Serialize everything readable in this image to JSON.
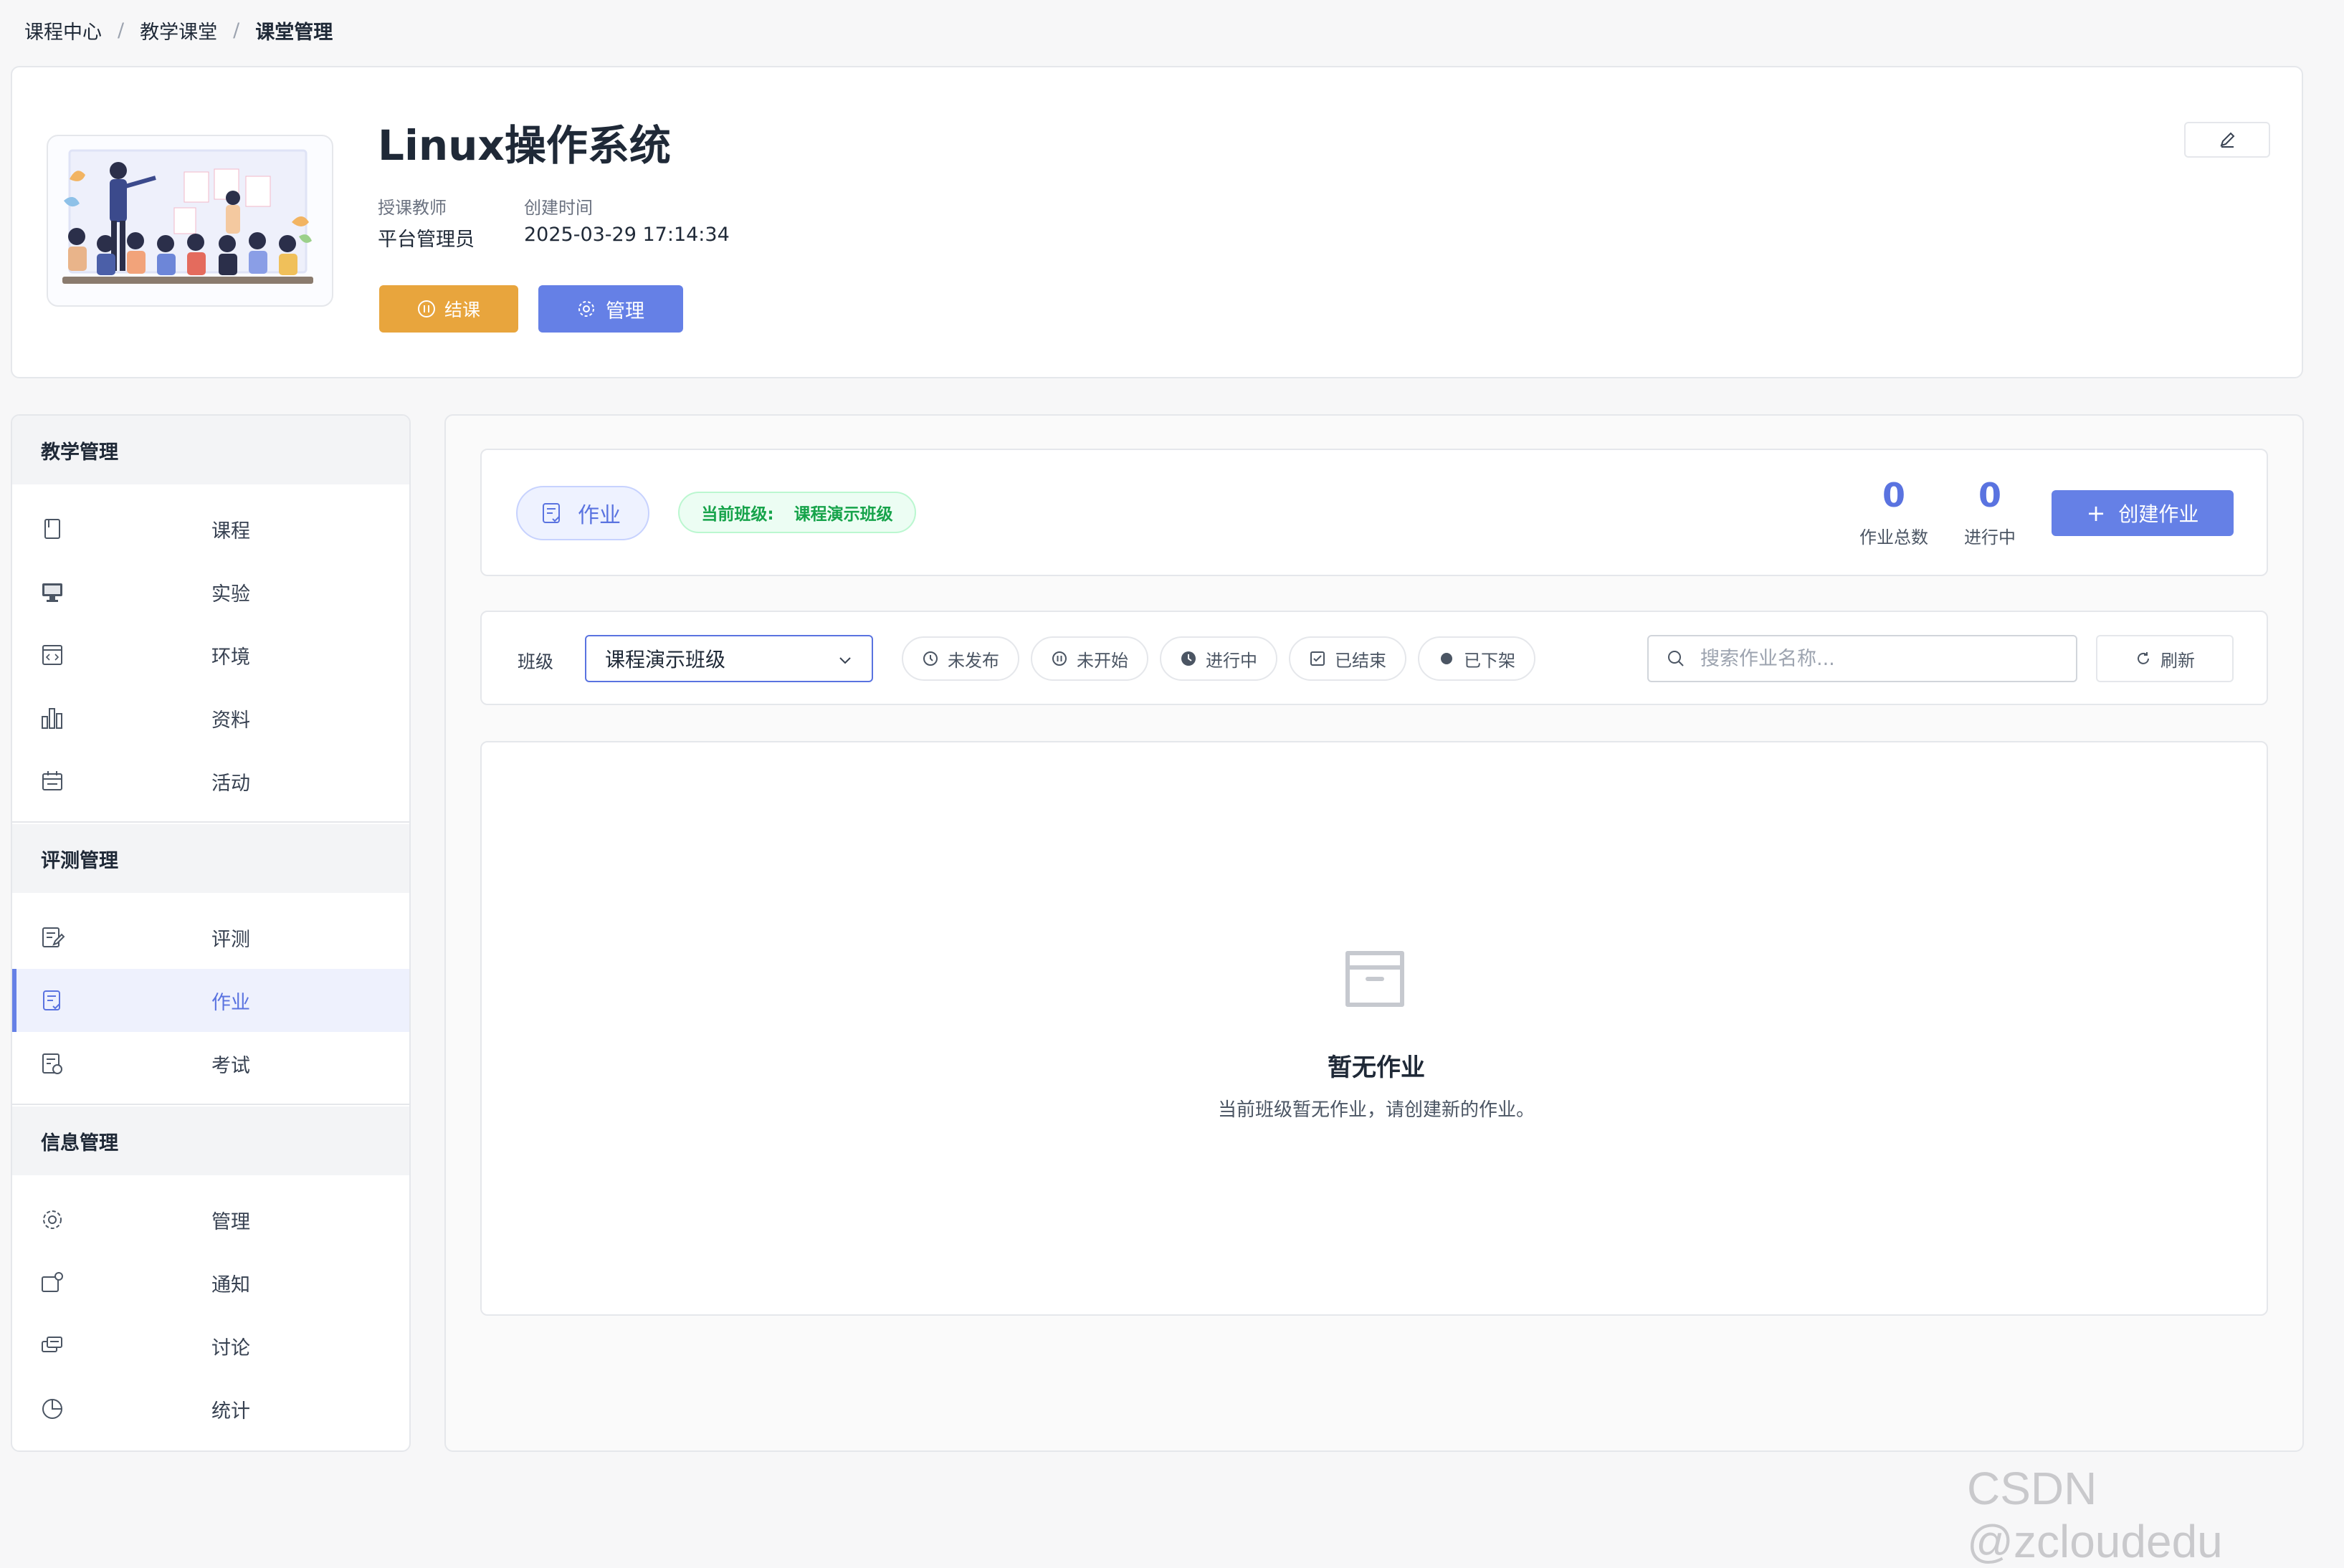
{
  "breadcrumb": {
    "items": [
      "课程中心",
      "教学课堂",
      "课堂管理"
    ]
  },
  "course": {
    "title": "Linux操作系统",
    "teacher_label": "授课教师",
    "teacher": "平台管理员",
    "created_label": "创建时间",
    "created": "2025-03-29 17:14:34",
    "end_button": "结课",
    "manage_button": "管理"
  },
  "sidebar": {
    "groups": [
      {
        "title": "教学管理",
        "items": [
          {
            "label": "课程",
            "icon": "book-icon"
          },
          {
            "label": "实验",
            "icon": "monitor-icon"
          },
          {
            "label": "环境",
            "icon": "code-window-icon"
          },
          {
            "label": "资料",
            "icon": "bar-chart-icon"
          },
          {
            "label": "活动",
            "icon": "calendar-icon"
          }
        ]
      },
      {
        "title": "评测管理",
        "items": [
          {
            "label": "评测",
            "icon": "edit-document-icon"
          },
          {
            "label": "作业",
            "icon": "assignment-icon",
            "active": true
          },
          {
            "label": "考试",
            "icon": "exam-icon"
          }
        ]
      },
      {
        "title": "信息管理",
        "items": [
          {
            "label": "管理",
            "icon": "gear-icon"
          },
          {
            "label": "通知",
            "icon": "notification-icon"
          },
          {
            "label": "讨论",
            "icon": "chat-icon"
          },
          {
            "label": "统计",
            "icon": "pie-chart-icon"
          }
        ]
      }
    ]
  },
  "homework": {
    "tab_label": "作业",
    "class_prefix": "当前班级:",
    "class_name": "课程演示班级",
    "stats": [
      {
        "value": "0",
        "label": "作业总数"
      },
      {
        "value": "0",
        "label": "进行中"
      }
    ],
    "create_button": "创建作业"
  },
  "filters": {
    "class_label": "班级",
    "class_selected": "课程演示班级",
    "statuses": [
      "未发布",
      "未开始",
      "进行中",
      "已结束",
      "已下架"
    ],
    "search_placeholder": "搜索作业名称...",
    "refresh_button": "刷新"
  },
  "empty_state": {
    "title": "暂无作业",
    "description": "当前班级暂无作业，请创建新的作业。"
  },
  "watermark": "CSDN @zcloudedu",
  "colors": {
    "accent": "#6580e6",
    "warning": "#e8a53d",
    "success": "#16a34a"
  }
}
